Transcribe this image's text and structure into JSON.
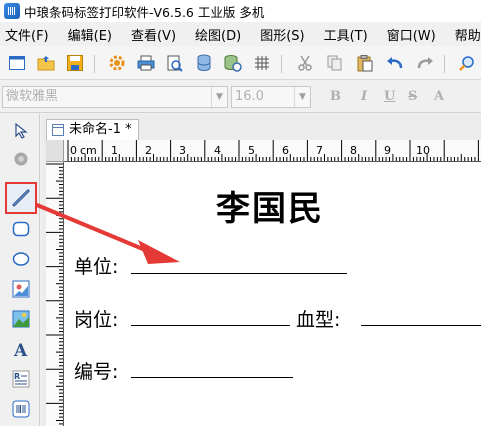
{
  "window": {
    "title": "中琅条码标签打印软件-V6.5.6 工业版 多机"
  },
  "menu": [
    {
      "label": "文件(F)"
    },
    {
      "label": "编辑(E)"
    },
    {
      "label": "查看(V)"
    },
    {
      "label": "绘图(D)"
    },
    {
      "label": "图形(S)"
    },
    {
      "label": "工具(T)"
    },
    {
      "label": "窗口(W)"
    },
    {
      "label": "帮助(H)"
    }
  ],
  "fontbar": {
    "font_name": "微软雅黑",
    "font_size": "16.0",
    "bold": "B",
    "italic": "I",
    "underline": "U",
    "strike": "S",
    "superscript": "A"
  },
  "document": {
    "tab_label": "未命名-1 *",
    "ruler_unit": "cm",
    "ruler_numbers": [
      "0",
      "1",
      "2",
      "3",
      "4",
      "5",
      "6",
      "7",
      "8",
      "9",
      "10"
    ]
  },
  "label": {
    "name": "李国民",
    "unit_label": "单位:",
    "position_label": "岗位:",
    "blood_label": "血型:",
    "number_label": "编号:"
  },
  "colors": {
    "highlight": "#e53935",
    "canvas": "#ffffff"
  }
}
